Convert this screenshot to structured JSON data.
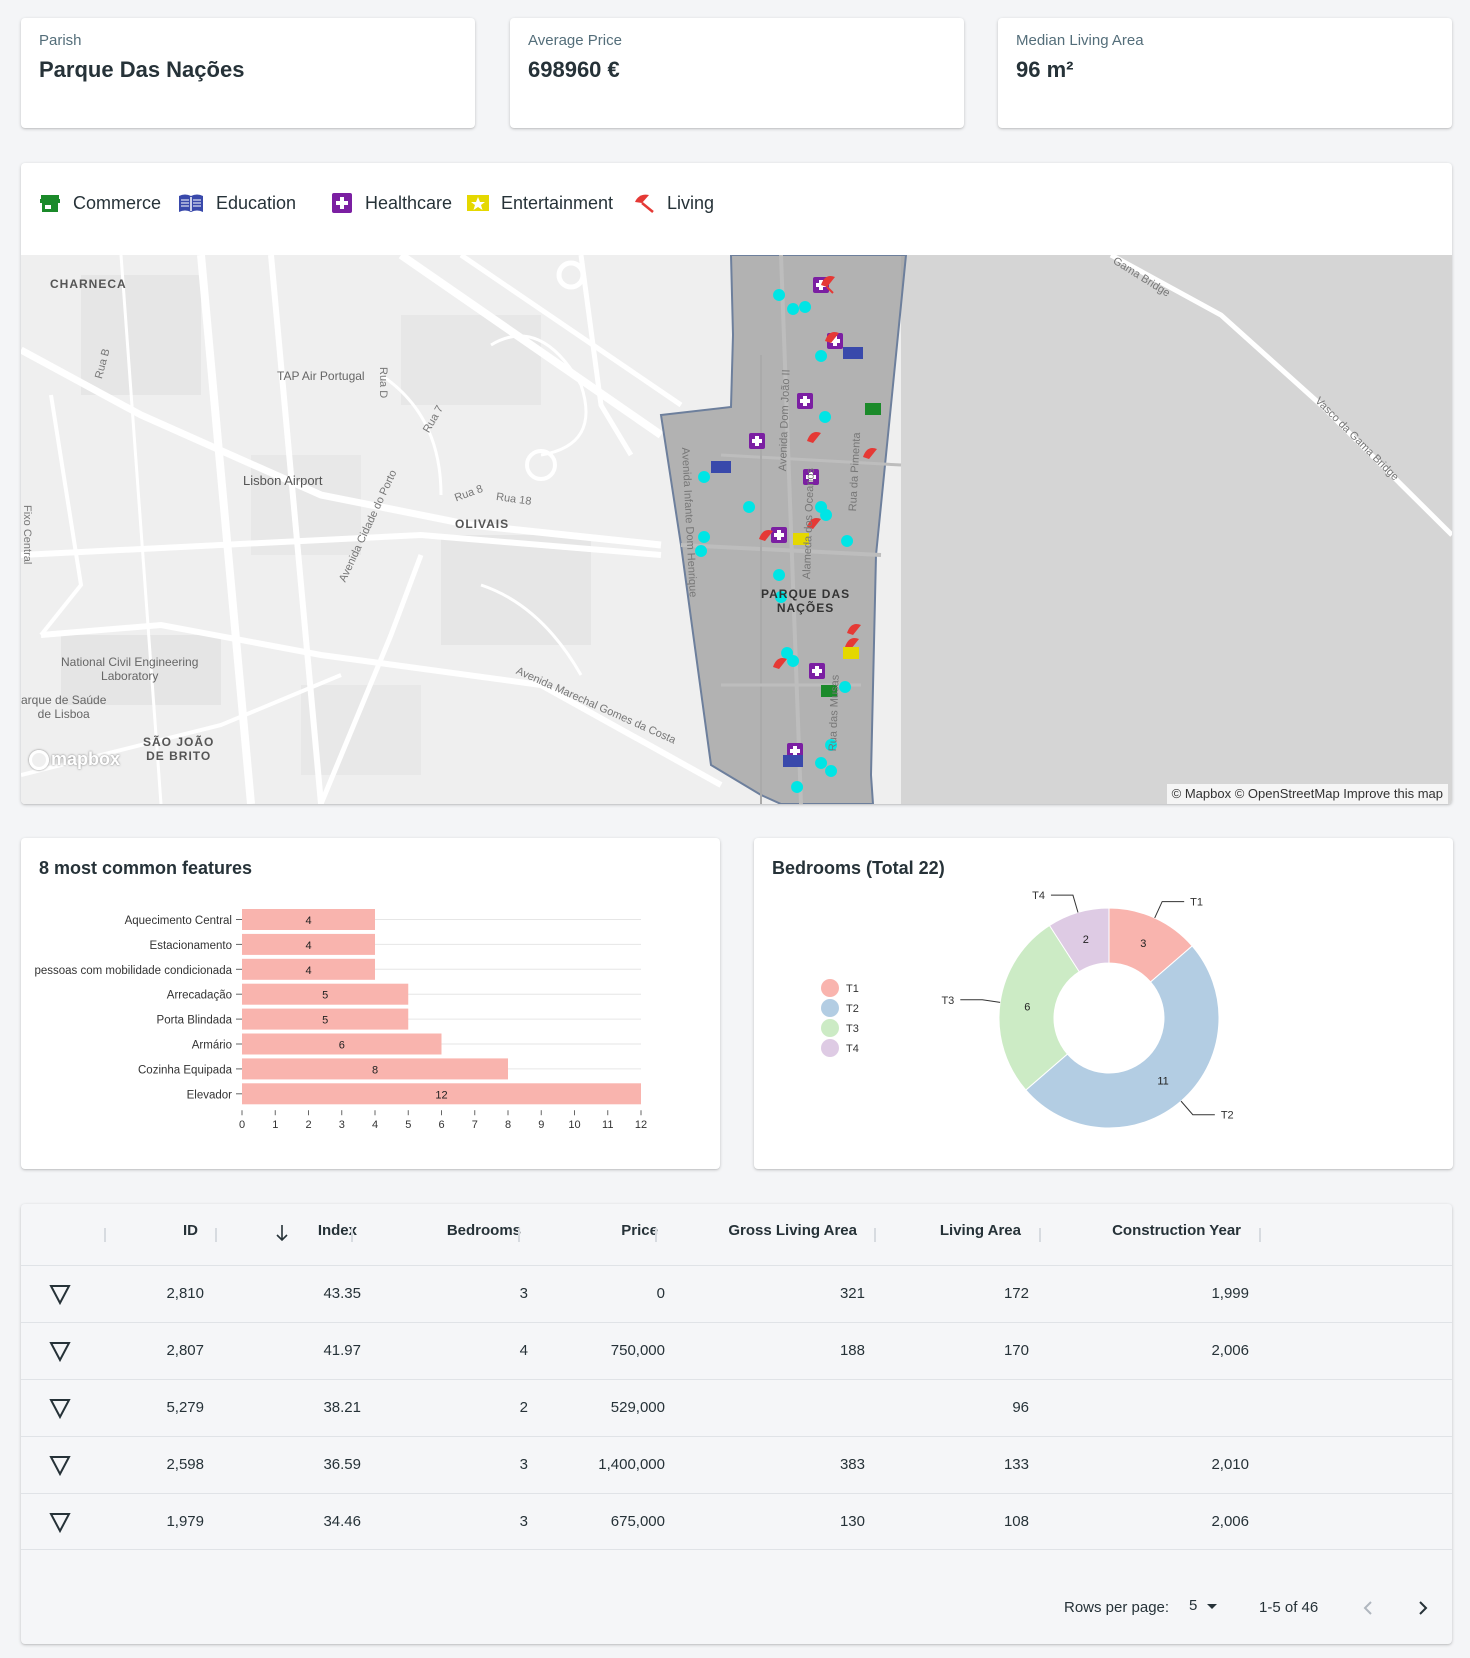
{
  "stats": [
    {
      "label": "Parish",
      "value": "Parque Das Nações"
    },
    {
      "label": "Average Price",
      "value": "698960 €"
    },
    {
      "label": "Median Living Area",
      "value": "96 m²"
    }
  ],
  "map": {
    "legend": [
      {
        "label": "Commerce",
        "icon": "store-icon",
        "color": "#1b8a2a"
      },
      {
        "label": "Education",
        "icon": "book-icon",
        "color": "#3949ab"
      },
      {
        "label": "Healthcare",
        "icon": "medical-cross-icon",
        "color": "#7b1fa2"
      },
      {
        "label": "Entertainment",
        "icon": "star-icon",
        "color": "#e5d800"
      },
      {
        "label": "Living",
        "icon": "beach-umbrella-icon",
        "color": "#e53935"
      }
    ],
    "labels": {
      "charneca": "CHARNECA",
      "tap": "TAP Air Portugal",
      "airport": "Lisbon Airport",
      "olivais": "OLIVAIS",
      "lnec": "National Civil Engineering\nLaboratory",
      "parque_saude": "arque de Saúde\nde Lisboa",
      "sao_joao": "SÃO JOÃO\nDE BRITO",
      "parque_nacoes": "PARQUE DAS\nNAÇÕES",
      "rua_b": "Rua B",
      "rua_d": "Rua D",
      "rua_7": "Rua 7",
      "rua_8": "Rua 8",
      "rua_18": "Rua 18",
      "av_cidade_porto": "Avenida Cidade do Porto",
      "av_infante": "Avenida Infante Dom Henrique",
      "av_dom_joao": "Avenida Dom João II",
      "alameda": "Alameda dos Oceanos",
      "rua_pimenta": "Rua da Pimenta",
      "rua_musas": "Rua das Musas",
      "av_marechal": "Avenida Marechal Gomes da Costa",
      "fixo_central": "Fixo Central",
      "vasco_gama": "Vasco da Gama Bridge",
      "gama_bridge": "Gama Bridge"
    },
    "attribution": "© Mapbox © OpenStreetMap Improve this map",
    "logo": "mapbox"
  },
  "features_panel": {
    "title": "8 most common features"
  },
  "bedrooms_panel": {
    "title": "Bedrooms (Total 22)"
  },
  "chart_data": [
    {
      "type": "bar",
      "orientation": "horizontal",
      "title": "8 most common features",
      "categories": [
        "Aquecimento Central",
        "Estacionamento",
        "pessoas com mobilidade condicionada",
        "Arrecadação",
        "Porta Blindada",
        "Armário",
        "Cozinha Equipada",
        "Elevador"
      ],
      "values": [
        4,
        4,
        4,
        5,
        5,
        6,
        8,
        12
      ],
      "xlim": [
        0,
        12
      ],
      "xticks": [
        "0",
        "1",
        "2",
        "3",
        "4",
        "5",
        "6",
        "7",
        "8",
        "9",
        "10",
        "11",
        "12"
      ],
      "bar_color": "#f9b4ae",
      "grid": true
    },
    {
      "type": "pie",
      "donut": true,
      "title": "Bedrooms (Total 22)",
      "labels": [
        "T1",
        "T2",
        "T3",
        "T4"
      ],
      "values": [
        3,
        11,
        6,
        2
      ],
      "colors": [
        "#f9b4ae",
        "#b3cde3",
        "#ccebc5",
        "#decbe4"
      ],
      "legend": "left"
    }
  ],
  "table": {
    "headers": {
      "id": "ID",
      "index": "Index",
      "bedrooms": "Bedrooms",
      "price": "Price",
      "gross": "Gross Living Area",
      "living": "Living Area",
      "year": "Construction Year"
    },
    "rows": [
      {
        "id": "2,810",
        "index": "43.35",
        "bedrooms": "3",
        "price": "0",
        "gross": "321",
        "living": "172",
        "year": "1,999"
      },
      {
        "id": "2,807",
        "index": "41.97",
        "bedrooms": "4",
        "price": "750,000",
        "gross": "188",
        "living": "170",
        "year": "2,006"
      },
      {
        "id": "5,279",
        "index": "38.21",
        "bedrooms": "2",
        "price": "529,000",
        "gross": "",
        "living": "96",
        "year": ""
      },
      {
        "id": "2,598",
        "index": "36.59",
        "bedrooms": "3",
        "price": "1,400,000",
        "gross": "383",
        "living": "133",
        "year": "2,010"
      },
      {
        "id": "1,979",
        "index": "34.46",
        "bedrooms": "3",
        "price": "675,000",
        "gross": "130",
        "living": "108",
        "year": "2,006"
      }
    ],
    "pagination": {
      "rows_per_page_label": "Rows per page:",
      "rows_per_page": "5",
      "range": "1-5 of 46"
    }
  }
}
